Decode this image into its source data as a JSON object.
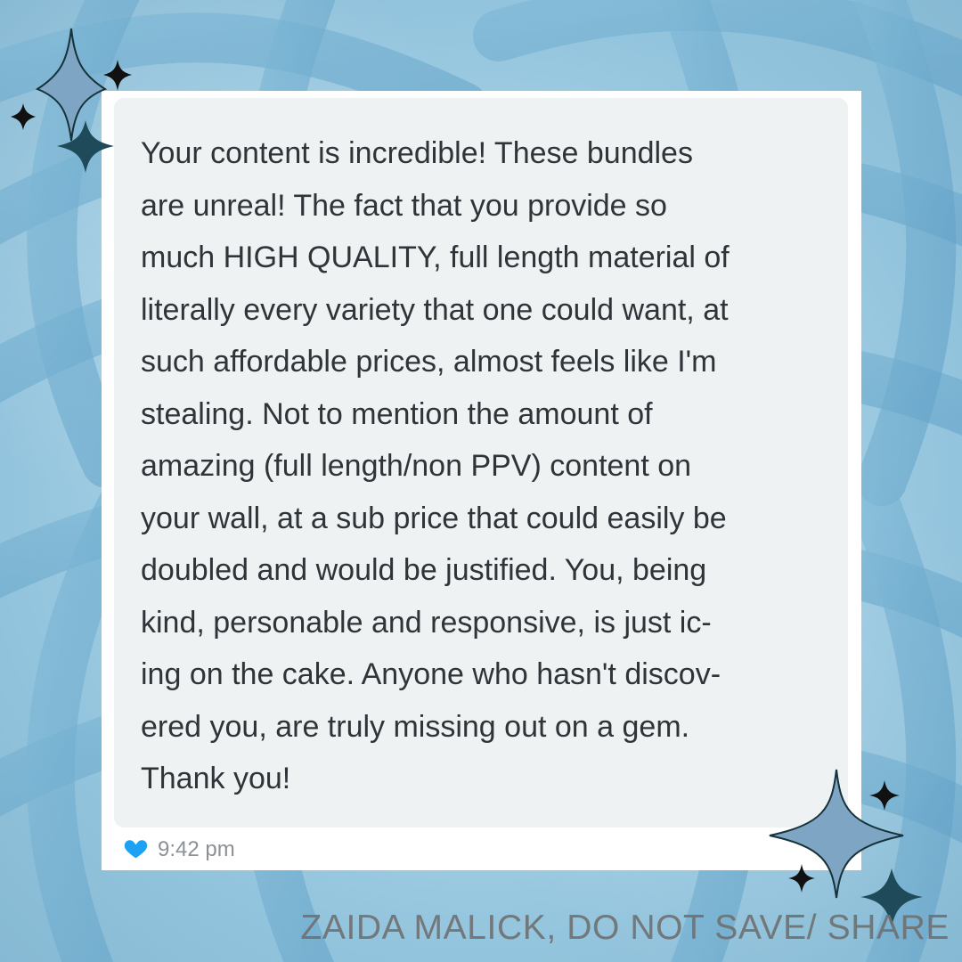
{
  "message": {
    "text": "Your content is incredible! These bundles\nare unreal! The fact that you provide so\nmuch HIGH QUALITY, full length material of\nliterally every variety that one could want, at\nsuch affordable prices, almost feels like I'm\nstealing. Not to mention the amount of\namazing (full length/non PPV) content on\nyour wall, at a sub price that could easily be\ndoubled and would be justified. You, being\nkind, personable and responsive, is just ic-\ning on the cake. Anyone who hasn't discov-\nered you, are truly missing out on a gem.\nThank you!"
  },
  "meta": {
    "timestamp": "9:42 pm"
  },
  "watermark": {
    "text": "ZAIDA MALICK, DO NOT SAVE/ SHARE"
  },
  "icons": {
    "heart": "heart-icon",
    "sparkle": "sparkle-icon"
  },
  "colors": {
    "background": "#9ecce2",
    "card": "#ffffff",
    "bubble": "#eef2f3",
    "text": "#2f3439",
    "timestamp": "#8b9196",
    "heart": "#1da1f2",
    "sparkle_dark": "#1f4a5a",
    "sparkle_light": "#7ea6c4",
    "watermark": "#6f6f6f"
  }
}
